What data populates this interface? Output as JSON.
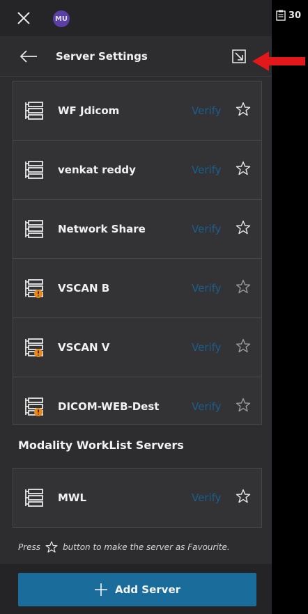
{
  "topbar": {
    "avatar_initials": "MU"
  },
  "right_strip": {
    "badge_count": "30"
  },
  "header": {
    "title": "Server Settings"
  },
  "servers": [
    {
      "name": "WF Jdicom",
      "verify": "Verify",
      "icon": "server-icon",
      "warning": false
    },
    {
      "name": "venkat reddy",
      "verify": "Verify",
      "icon": "server-icon",
      "warning": false
    },
    {
      "name": "Network Share",
      "verify": "Verify",
      "icon": "server-icon",
      "warning": false
    },
    {
      "name": "VSCAN B",
      "verify": "Verify",
      "icon": "server-warning-icon",
      "warning": true
    },
    {
      "name": "VSCAN V",
      "verify": "Verify",
      "icon": "server-warning-icon",
      "warning": true
    },
    {
      "name": "DICOM-WEB-Dest",
      "verify": "Verify",
      "icon": "server-warning-icon",
      "warning": true
    }
  ],
  "modality_section": {
    "title": "Modality WorkList Servers",
    "servers": [
      {
        "name": "MWL",
        "verify": "Verify",
        "icon": "server-icon",
        "warning": false
      }
    ]
  },
  "hint": {
    "before": "Press",
    "after": "button to make the server as Favourite."
  },
  "footer": {
    "add_label": "Add Server"
  },
  "colors": {
    "panel": "#2d2d2f",
    "accent": "#1a6d9a",
    "verify_text": "#1b5e8c",
    "warning": "#e8891f",
    "annotation_arrow": "#e3181b"
  }
}
